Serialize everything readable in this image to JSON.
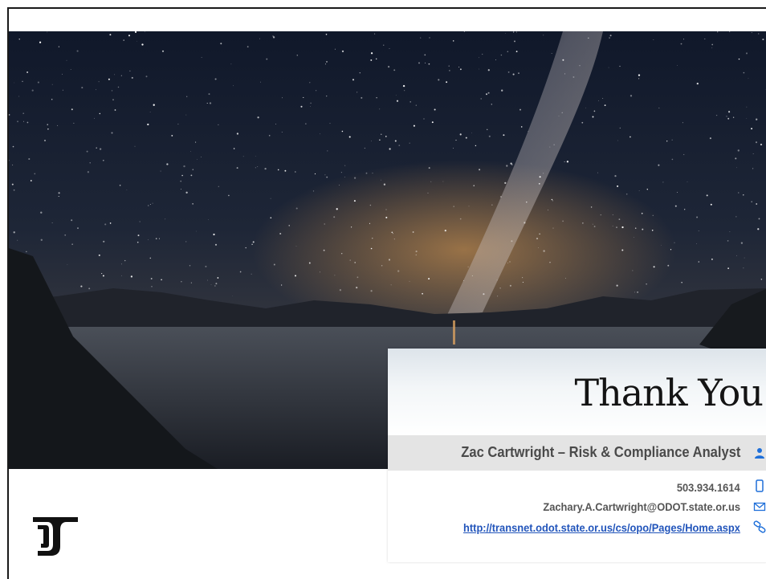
{
  "slide": {
    "title": "Thank You",
    "contact": {
      "name_line": "Zac Cartwright – Risk & Compliance Analyst",
      "phone": "503.934.1614",
      "email": "Zachary.A.Cartwright@ODOT.state.or.us",
      "url": "http://transnet.odot.state.or.us/cs/opo/Pages/Home.aspx"
    },
    "icons": {
      "person": "person-icon",
      "phone": "mobile-phone-icon",
      "email": "envelope-icon",
      "link": "link-icon",
      "logo": "odot-logo"
    },
    "colors": {
      "accent_blue": "#1e6fd9",
      "link_blue": "#2255bb",
      "text_gray": "#555555",
      "name_bar": "#e4e4e4",
      "sky_top": "#10182a",
      "sky_bottom": "#3b3a3c"
    }
  }
}
